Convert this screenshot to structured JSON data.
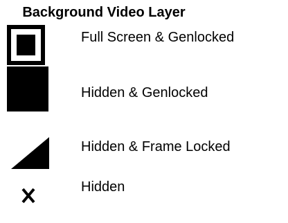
{
  "title": "Background Video Layer",
  "legend": [
    {
      "icon": "framed-square-icon",
      "label": "Full Screen & Genlocked"
    },
    {
      "icon": "filled-square-icon",
      "label": "Hidden & Genlocked"
    },
    {
      "icon": "triangle-icon",
      "label": "Hidden & Frame Locked"
    },
    {
      "icon": "x-icon",
      "label": "Hidden"
    }
  ],
  "colors": {
    "text": "#000000",
    "icon": "#000000",
    "background": "#ffffff"
  }
}
